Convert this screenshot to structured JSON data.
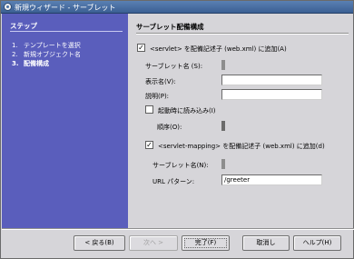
{
  "window": {
    "title": "新規ウィザード - サーブレット"
  },
  "steps": {
    "heading": "ステップ",
    "items": [
      {
        "num": "1.",
        "label": "テンプレートを選択",
        "active": false
      },
      {
        "num": "2.",
        "label": "新規オブジェクト名",
        "active": false
      },
      {
        "num": "3.",
        "label": "配備構成",
        "active": true
      }
    ]
  },
  "form": {
    "heading": "サーブレット配備構成",
    "add_servlet": {
      "checked": true,
      "label": "<servlet> を配備記述子 (web.xml) に追加(A)"
    },
    "servlet_name": {
      "label": "サーブレット名 (S):"
    },
    "display_name": {
      "label": "表示名(V):",
      "value": ""
    },
    "description": {
      "label": "説明(P):",
      "value": ""
    },
    "load_on_startup": {
      "checked": false,
      "label": "起動時に読み込み(I)"
    },
    "order": {
      "label": "順序(O):"
    },
    "add_mapping": {
      "checked": true,
      "label": "<servlet-mapping> を配備記述子 (web.xml) に追加(d)"
    },
    "mapping_servlet_name": {
      "label": "サーブレット名(N):"
    },
    "url_pattern": {
      "label": "URL パターン:",
      "value": "/greeter"
    }
  },
  "buttons": {
    "back": "< 戻る(B)",
    "next": "次へ >",
    "finish": "完了(F)",
    "cancel": "取消し",
    "help": "ヘルプ(H)"
  },
  "colors": {
    "steps_panel": "#5a5ebc",
    "titlebar": "#4a6fa2",
    "dialog_bg": "#d6d5d9"
  }
}
